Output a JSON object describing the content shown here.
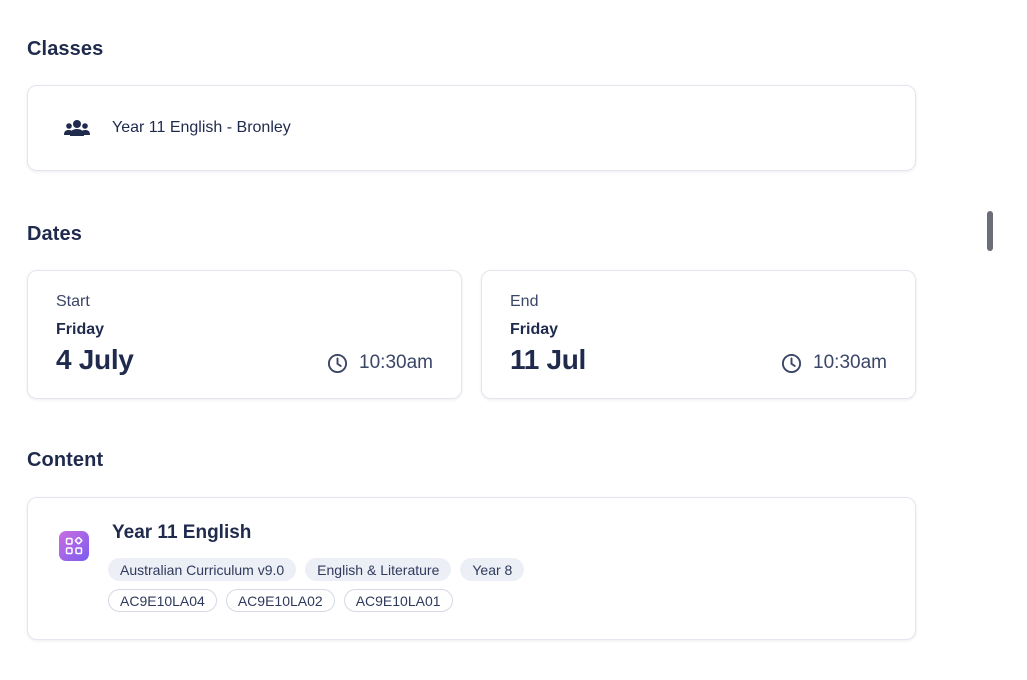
{
  "classes": {
    "title": "Classes",
    "items": [
      {
        "label": "Year 11 English - Bronley",
        "icon": "users-group-icon"
      }
    ]
  },
  "dates": {
    "title": "Dates",
    "start": {
      "kind": "Start",
      "weekday": "Friday",
      "date": "4 July",
      "time": "10:30am",
      "icon": "clock-icon"
    },
    "end": {
      "kind": "End",
      "weekday": "Friday",
      "date": "11 Jul",
      "time": "10:30am",
      "icon": "clock-icon"
    }
  },
  "content": {
    "title": "Content",
    "item": {
      "title": "Year 11 English",
      "icon": "apps-icon",
      "tags": [
        "Australian Curriculum v9.0",
        "English & Literature",
        "Year 8"
      ],
      "codes": [
        "AC9E10LA04",
        "AC9E10LA02",
        "AC9E10LA01"
      ]
    }
  },
  "colors": {
    "text": "#1f2a4d",
    "tag_bg": "#eceff5",
    "icon_gradient_start": "#c96ee0",
    "icon_gradient_end": "#7b5cf0"
  }
}
